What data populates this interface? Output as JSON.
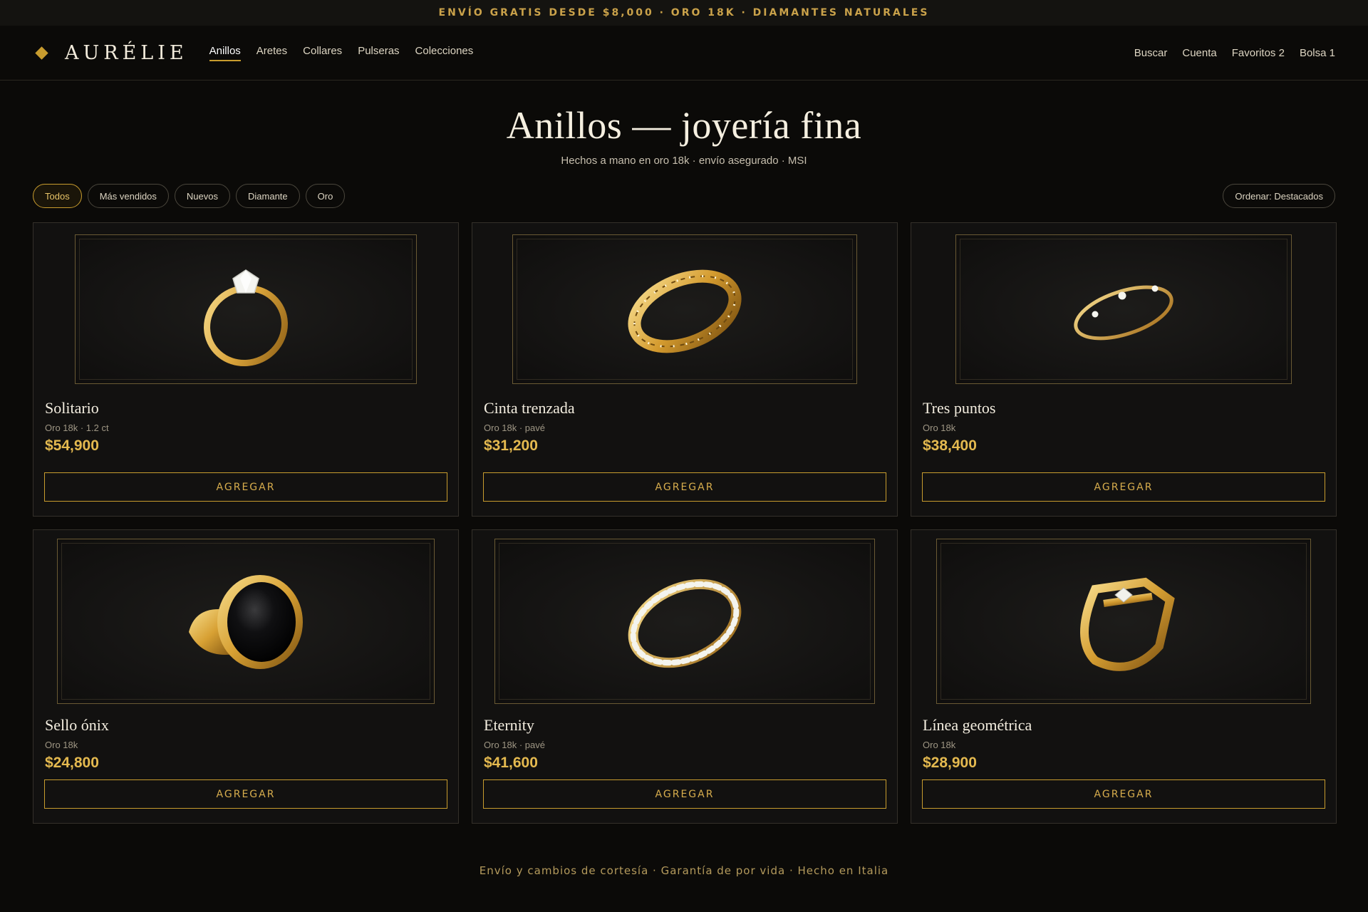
{
  "announcement": "ENVÍO GRATIS DESDE $8,000 · ORO 18K · DIAMANTES NATURALES",
  "brand": "AURÉLIE",
  "nav": {
    "links": [
      "Anillos",
      "Aretes",
      "Collares",
      "Pulseras",
      "Colecciones"
    ],
    "active": "Anillos",
    "utilities": [
      "Buscar",
      "Cuenta",
      "Favoritos 2",
      "Bolsa 1"
    ]
  },
  "hero": {
    "title": "Anillos — joyería fina",
    "subtitle": "Hechos a mano en oro 18k · envío asegurado · MSI"
  },
  "filters": {
    "chips": [
      "Todos",
      "Más vendidos",
      "Nuevos",
      "Diamante",
      "Oro"
    ],
    "active": "Todos",
    "sort_label": "Ordenar: Destacados"
  },
  "products": [
    {
      "name": "Solitario",
      "meta": "Oro 18k · 1.2 ct",
      "price": "$54,900",
      "button": "AGREGAR",
      "icon": "solitaire-ring-icon"
    },
    {
      "name": "Cinta trenzada",
      "meta": "Oro 18k · pavé",
      "price": "$31,200",
      "button": "AGREGAR",
      "icon": "braided-ring-icon"
    },
    {
      "name": "Tres puntos",
      "meta": "Oro 18k",
      "price": "$38,400",
      "button": "AGREGAR",
      "icon": "three-stone-ring-icon"
    },
    {
      "name": "Sello ónix",
      "meta": "Oro 18k",
      "price": "$24,800",
      "button": "AGREGAR",
      "icon": "onyx-signet-ring-icon"
    },
    {
      "name": "Eternity",
      "meta": "Oro 18k · pavé",
      "price": "$41,600",
      "button": "AGREGAR",
      "icon": "eternity-ring-icon"
    },
    {
      "name": "Línea geométrica",
      "meta": "Oro 18k",
      "price": "$28,900",
      "button": "AGREGAR",
      "icon": "geometric-ring-icon"
    }
  ],
  "footer": "Envío y cambios de cortesía · Garantía de por vida · Hecho en Italia",
  "colors": {
    "accent": "#c89c2e",
    "background": "#0b0a08",
    "price": "#e4b94f"
  }
}
